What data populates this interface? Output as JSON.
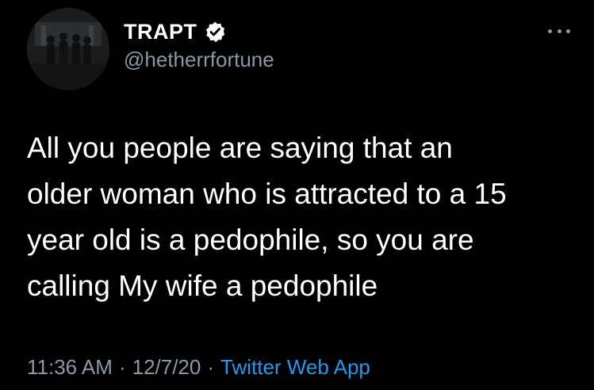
{
  "user": {
    "display_name": "TRAPT",
    "handle": "@hetherrfortune",
    "verified": true,
    "avatar_icon": "band-photo-avatar"
  },
  "tweet": {
    "text": "All you people are saying that an\nolder woman who is attracted to a 15\nyear old is a pedophile, so you are\ncalling My wife a pedophile",
    "time": "11:36 AM",
    "separator_1": "·",
    "date": "12/7/20",
    "separator_2": "·",
    "source": "Twitter Web App"
  },
  "menu": {
    "icon": "more-options-icon"
  },
  "colors": {
    "background": "#000000",
    "text_primary": "#ffffff",
    "text_secondary": "#8b98a5",
    "link": "#1d9bf0",
    "verified_badge": "#ffffff"
  }
}
